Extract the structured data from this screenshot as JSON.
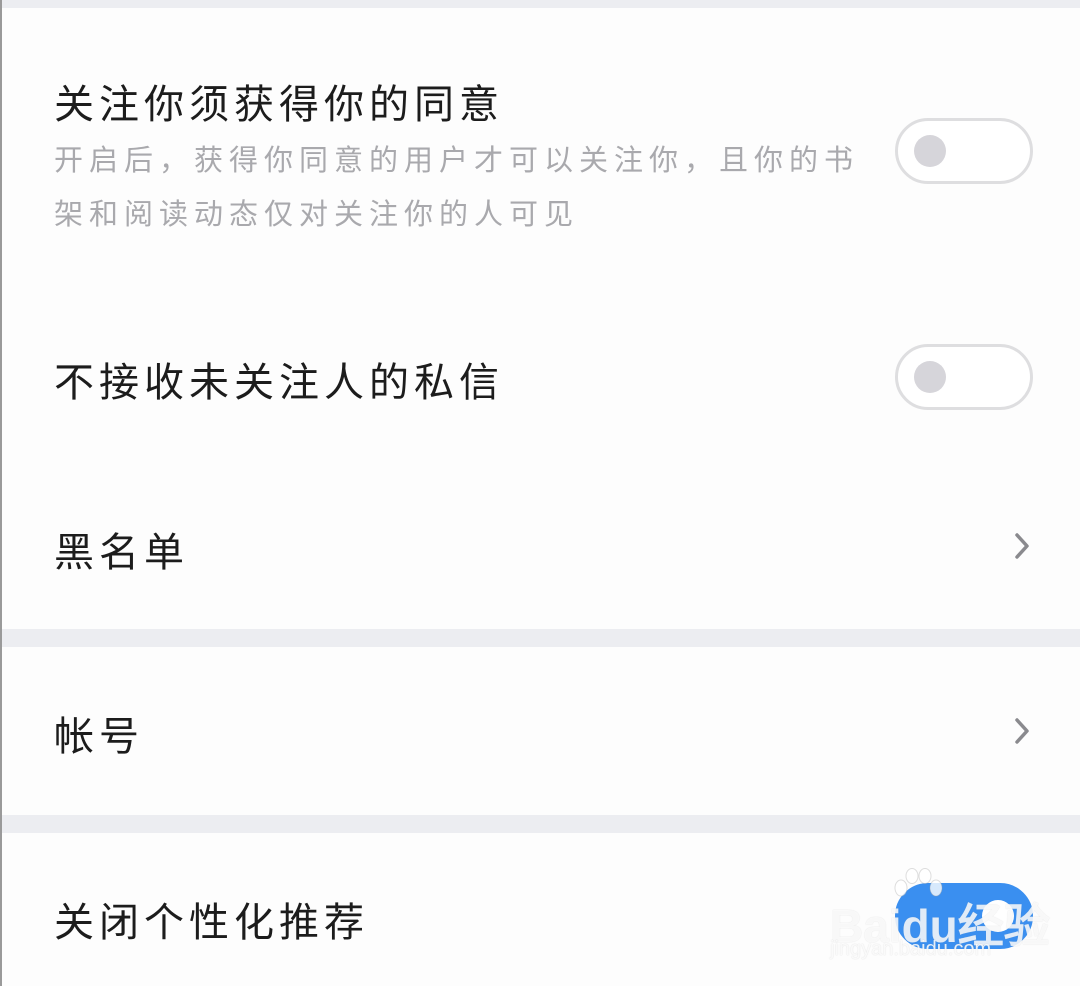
{
  "privacy": {
    "follow_consent": {
      "title": "关注你须获得你的同意",
      "description": "开启后，获得你同意的用户才可以关注你，且你的书架和阅读动态仅对关注你的人可见",
      "enabled": false
    },
    "no_stranger_messages": {
      "title": "不接收未关注人的私信",
      "enabled": false
    },
    "blacklist": {
      "title": "黑名单"
    }
  },
  "account": {
    "title": "帐号"
  },
  "recommendation": {
    "title": "关闭个性化推荐",
    "enabled": true
  },
  "colors": {
    "toggle_on": "#3a8ff0",
    "toggle_off_border": "#dedee0",
    "section_gap": "#ecedf1"
  },
  "icons": {
    "chevron": "chevron-right-icon"
  },
  "watermark": {
    "logo": "Baidu经验",
    "url": "jingyan.baidu.com"
  }
}
